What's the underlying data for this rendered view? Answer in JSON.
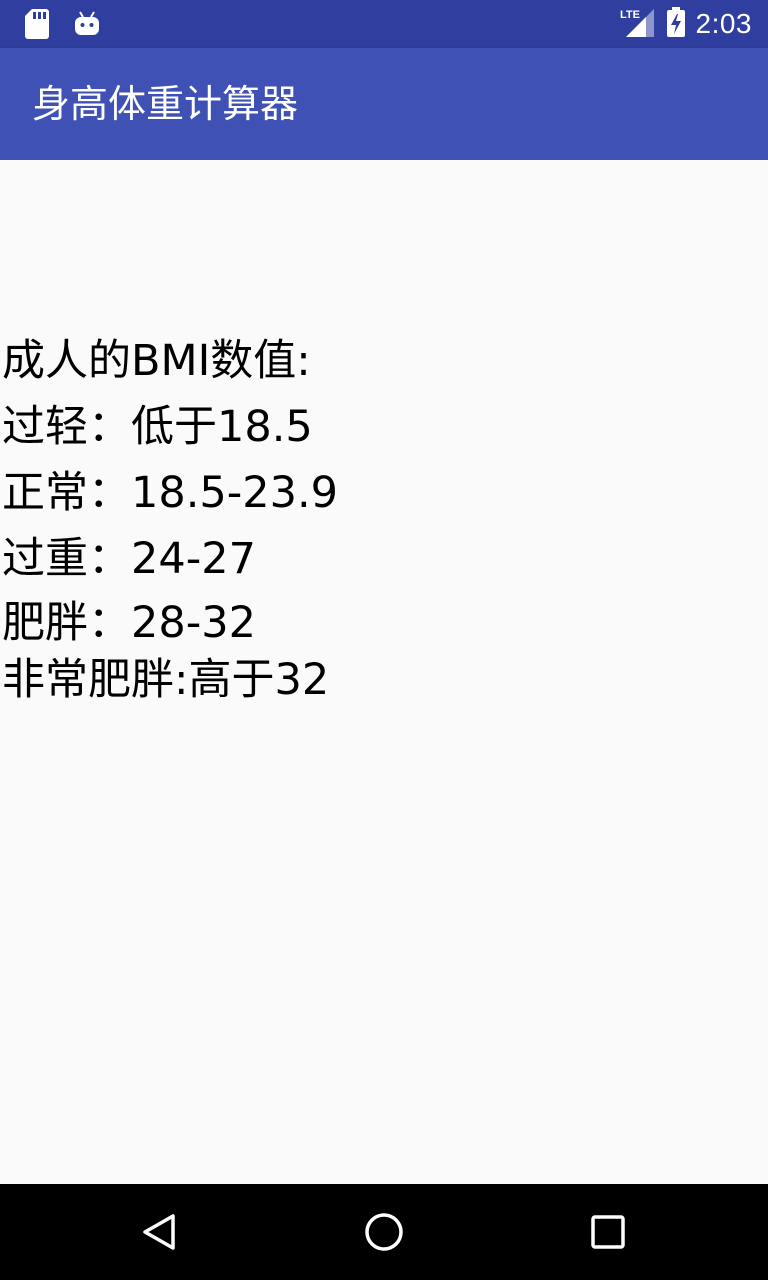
{
  "status_bar": {
    "time": "2:03",
    "network_label": "LTE",
    "icons": [
      "sd-card-icon",
      "android-icon",
      "lte-signal-icon",
      "battery-charging-icon"
    ]
  },
  "app_bar": {
    "title": "身高体重计算器"
  },
  "bmi_info": {
    "heading": "成人的BMI数值:",
    "lines": [
      "过轻：低于18.5",
      "正常：18.5-23.9",
      "过重：24-27",
      "肥胖：28-32",
      "非常肥胖:高于32"
    ]
  },
  "nav_bar": {
    "icons": [
      "back-icon",
      "home-icon",
      "recents-icon"
    ]
  },
  "colors": {
    "status_bar": "#303f9f",
    "app_bar": "#3f51b5",
    "background": "#fafafa",
    "nav_bar": "#000000",
    "text": "#000000"
  }
}
